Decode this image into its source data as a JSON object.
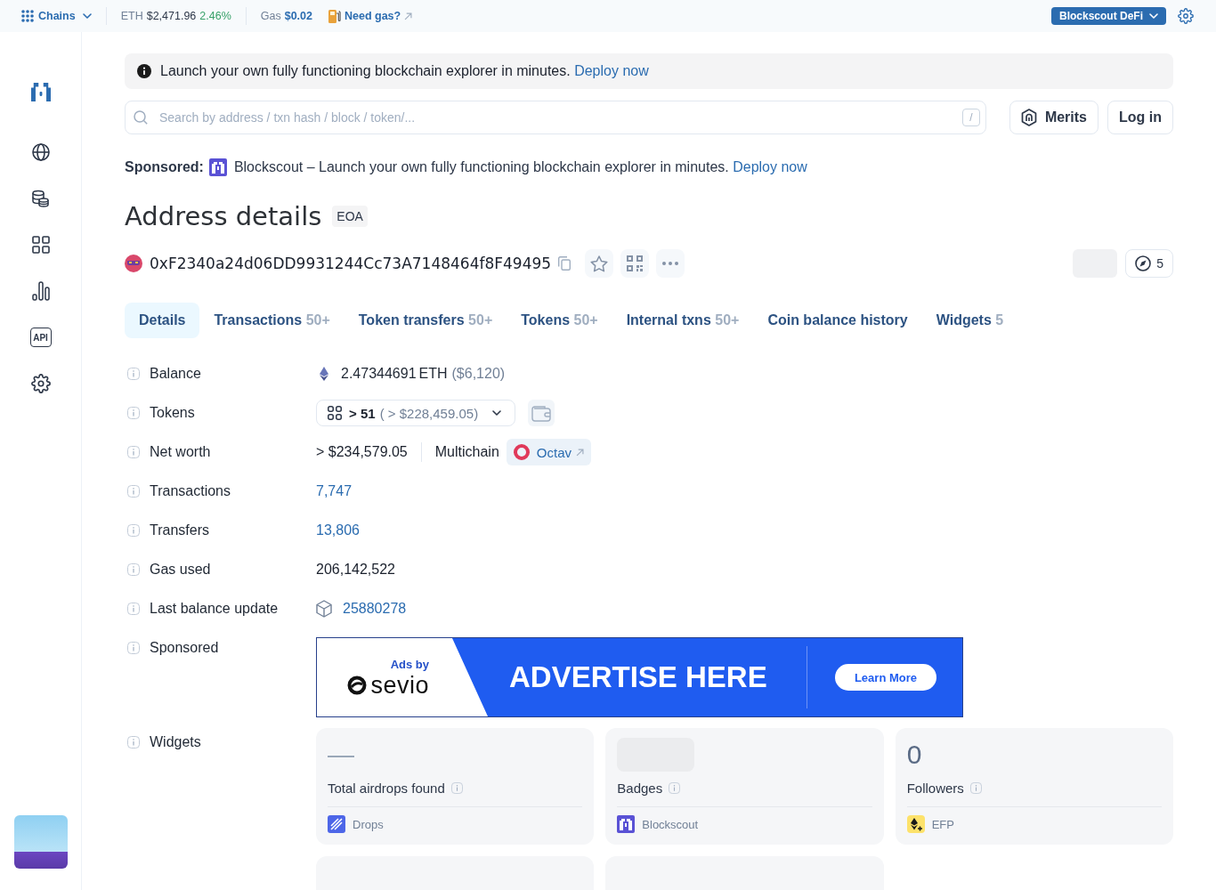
{
  "top_bar": {
    "chains_label": "Chains",
    "coin": {
      "symbol": "ETH",
      "price": "$2,471.96",
      "change": "2.46%"
    },
    "gas": {
      "label": "Gas",
      "price": "$0.02",
      "link": "Need gas?"
    },
    "network_button": "Blockscout DeFi"
  },
  "sidebar": {
    "api_label": "API"
  },
  "banner": {
    "text": "Launch your own fully functioning blockchain explorer in minutes.",
    "link": "Deploy now"
  },
  "search": {
    "placeholder": "Search by address / txn hash / block / token/...",
    "shortcut": "/"
  },
  "header_buttons": [
    {
      "kind": "merits",
      "label": "Merits"
    },
    {
      "kind": "login",
      "label": "Log in"
    }
  ],
  "sponsored": {
    "label": "Sponsored:",
    "text": "Blockscout – Launch your own fully functioning blockchain explorer in minutes.",
    "link": "Deploy now"
  },
  "page_title": "Address details",
  "address_type": "EOA",
  "address": {
    "hash": "0xF2340a24d06DD9931244Cc73A7148464f8F49495",
    "counter": "5"
  },
  "tabs": [
    {
      "label": "Details",
      "selected": true
    },
    {
      "label": "Transactions",
      "count": "50+",
      "selected": false
    },
    {
      "label": "Token transfers",
      "count": "50+",
      "selected": false
    },
    {
      "label": "Tokens",
      "count": "50+",
      "selected": false
    },
    {
      "label": "Internal txns",
      "count": "50+",
      "selected": false
    },
    {
      "label": "Coin balance history",
      "selected": false
    },
    {
      "label": "Widgets",
      "count": "5",
      "selected": false
    }
  ],
  "details": [
    {
      "kind": "balance",
      "label": "Balance",
      "amount": "2.47344691",
      "unit": "ETH",
      "usd": "($6,120)"
    },
    {
      "kind": "tokens",
      "label": "Tokens",
      "count": "> 51",
      "usd": "( > $228,459.05)"
    },
    {
      "kind": "net_worth",
      "label": "Net worth",
      "value": "> $234,579.05",
      "multichain": "Multichain",
      "link": "Octav"
    },
    {
      "kind": "link",
      "label": "Transactions",
      "value": "7,747"
    },
    {
      "kind": "link",
      "label": "Transfers",
      "value": "13,806"
    },
    {
      "kind": "text",
      "label": "Gas used",
      "value": "206,142,522"
    },
    {
      "kind": "block",
      "label": "Last balance update",
      "value": "25880278"
    },
    {
      "kind": "ad",
      "label": "Sponsored",
      "ad": {
        "caption": "Ads by",
        "brand": "sevio",
        "headline": "ADVERTISE HERE",
        "button": "Learn More"
      }
    },
    {
      "kind": "widgets",
      "label": "Widgets",
      "widgets": [
        {
          "value": "—",
          "muted": true,
          "title": "Total airdrops found",
          "source": "Drops",
          "loading": false
        },
        {
          "title": "Badges",
          "source": "Blockscout",
          "loading": true
        },
        {
          "value": "0",
          "muted": false,
          "title": "Followers",
          "source": "EFP",
          "loading": false
        },
        {
          "loading": false
        },
        {
          "loading": false
        }
      ]
    }
  ]
}
